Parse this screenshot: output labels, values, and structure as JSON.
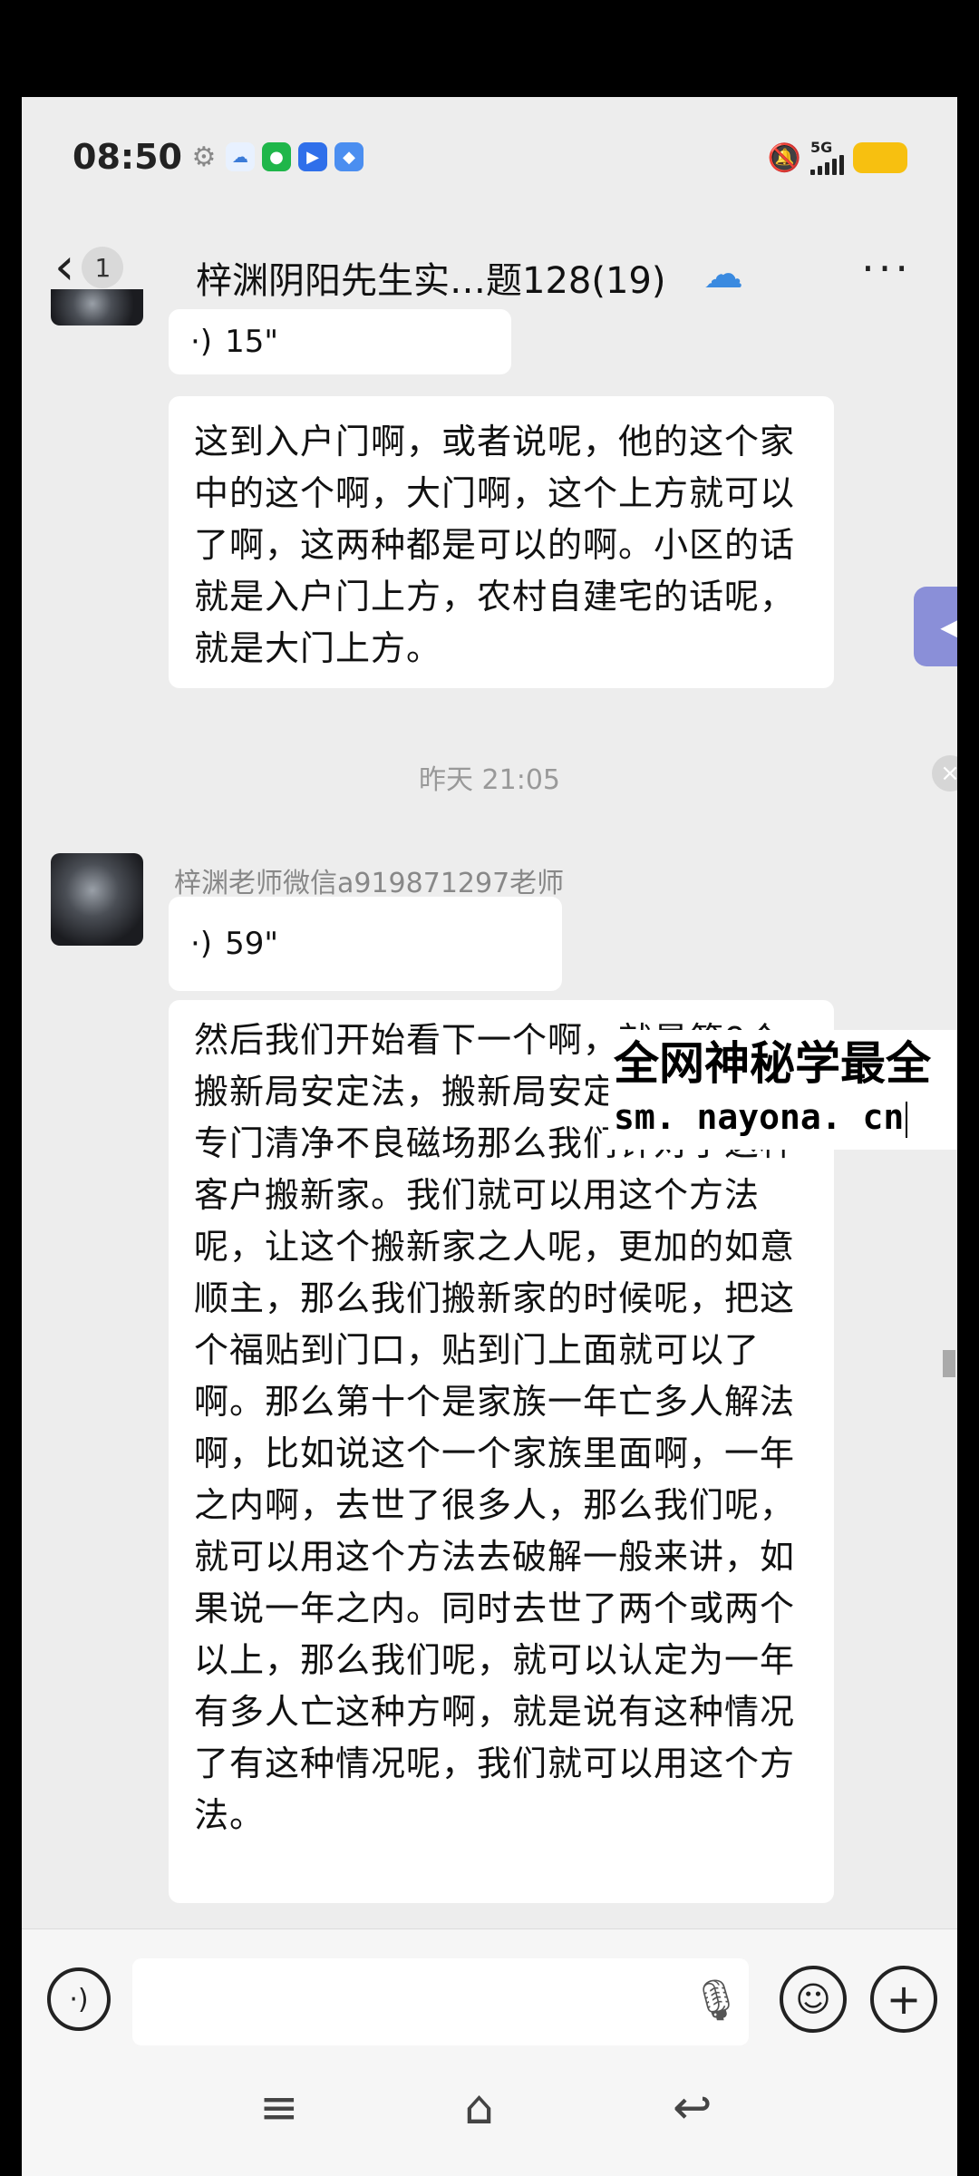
{
  "status_bar": {
    "time": "08:50",
    "network": "5G",
    "icons": [
      "gear-icon",
      "cloud-icon",
      "wechat-icon",
      "video-icon",
      "app-icon"
    ]
  },
  "header": {
    "back_count": "1",
    "title": "梓渊阴阳先生实…题128(19)"
  },
  "messages": {
    "voice1_duration": "15\"",
    "text1": "这到入户门啊，或者说呢，他的这个家中的这个啊，大门啊，这个上方就可以了啊，这两种都是可以的啊。小区的话就是入户门上方，农村自建宅的话呢，就是大门上方。",
    "timestamp": "昨天 21:05",
    "sender": "梓渊老师微信a919871297老师",
    "voice2_duration": "59\"",
    "text2": "然后我们开始看下一个啊，就是第9个搬新局安定法，搬新局安定法呢，它是专门清净不良磁场那么我们针对于这种客户搬新家。我们就可以用这个方法呢，让这个搬新家之人呢，更加的如意顺主，那么我们搬新家的时候呢，把这个福贴到门口，贴到门上面就可以了啊。那么第十个是家族一年亡多人解法啊，比如说这个一个家族里面啊，一年之内啊，去世了很多人，那么我们呢，就可以用这个方法去破解一般来讲，如果说一年之内。同时去世了两个或两个以上，那么我们呢，就可以认定为一年有多人亡这种方啊，就是说有这种情况了有这种情况呢，我们就可以用这个方法。"
  },
  "watermark": {
    "title": "全网神秘学最全",
    "url": "sm. nayona. cn"
  },
  "input": {
    "value": ""
  },
  "colors": {
    "background": "#ededed",
    "bubble": "#ffffff",
    "battery": "#f7c010",
    "float_widget": "#8a8fd8"
  }
}
